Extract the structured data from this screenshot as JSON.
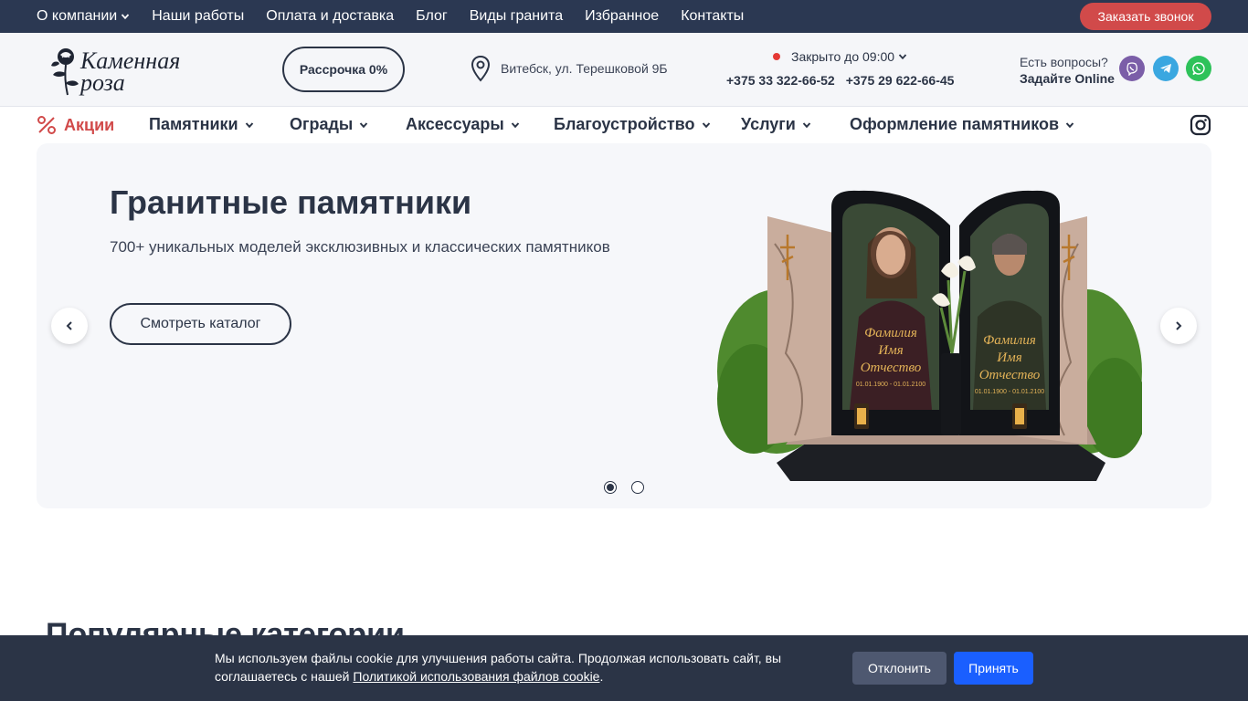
{
  "topbar": {
    "items": [
      {
        "label": "О компании",
        "has_dropdown": true
      },
      {
        "label": "Наши работы"
      },
      {
        "label": "Оплата и доставка"
      },
      {
        "label": "Блог"
      },
      {
        "label": "Виды гранита"
      },
      {
        "label": "Избранное"
      },
      {
        "label": "Контакты"
      }
    ],
    "call_button": "Заказать звонок"
  },
  "header": {
    "logo_line1": "Каменная",
    "logo_line2": "роза",
    "installment_button": "Рассрочка 0%",
    "address": "Витебск, ул. Терешковой 9Б",
    "hours": "Закрыто до 09:00",
    "phones": [
      "+375 33 322-66-52",
      "+375 29 622-66-45"
    ],
    "ask_line1": "Есть вопросы?",
    "ask_line2": "Задайте Online"
  },
  "mainnav": {
    "sale": "Акции",
    "items": [
      {
        "label": "Памятники"
      },
      {
        "label": "Ограды"
      },
      {
        "label": "Аксессуары"
      },
      {
        "label": "Благоустройство"
      },
      {
        "label": "Услуги"
      },
      {
        "label": "Оформление памятников"
      }
    ]
  },
  "hero": {
    "title": "Гранитные памятники",
    "subtitle": "700+ уникальных моделей эксклюзивных и классических памятников",
    "cta": "Смотреть каталог",
    "slides": 2,
    "active_slide": 1,
    "plaque_left": [
      "Фамилия",
      "Имя",
      "Отчество",
      "01.01.1900 - 01.01.2100"
    ],
    "plaque_right": [
      "Фамилия",
      "Имя",
      "Отчество",
      "01.01.1900 - 01.01.2100"
    ]
  },
  "section": {
    "title": "Популярные категории"
  },
  "cookie": {
    "text_before": "Мы используем файлы cookie для улучшения работы сайта. Продолжая использовать сайт, вы соглашаетесь с нашей ",
    "link": "Политикой использования файлов cookie",
    "text_after": ".",
    "decline": "Отклонить",
    "accept": "Принять"
  },
  "colors": {
    "dark": "#2b3852",
    "accent_red": "#d14a4a",
    "accept_blue": "#1a5fff"
  }
}
